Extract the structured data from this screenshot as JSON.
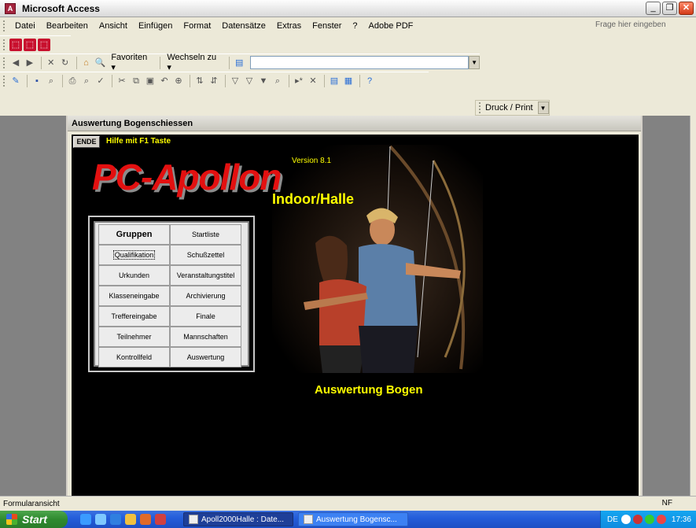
{
  "app": {
    "title": "Microsoft Access"
  },
  "menu": {
    "items": [
      "Datei",
      "Bearbeiten",
      "Ansicht",
      "Einfügen",
      "Format",
      "Datensätze",
      "Extras",
      "Fenster",
      "?",
      "Adobe PDF"
    ],
    "ask_placeholder": "Frage hier eingeben"
  },
  "web_toolbar": {
    "favoriten": "Favoriten ▾",
    "wechseln": "Wechseln zu ▾"
  },
  "print_toolbar": {
    "label": "Druck / Print"
  },
  "form": {
    "title": "Auswertung Bogenschiessen",
    "ende_label": "ENDE",
    "help_text": "Hilfe mit F1 Taste",
    "logo": "PC-Apollon",
    "version": "Version 8.1",
    "subtitle": "Indoor/Halle",
    "caption": "Auswertung Bogen",
    "buttons": [
      {
        "label": "Gruppen",
        "bold": true
      },
      {
        "label": "Startliste"
      },
      {
        "label": "Qualifikation",
        "focus": true
      },
      {
        "label": "Schußzettel"
      },
      {
        "label": "Urkunden"
      },
      {
        "label": "Veranstaltungstitel"
      },
      {
        "label": "Klasseneingabe"
      },
      {
        "label": "Archivierung"
      },
      {
        "label": "Treffereingabe"
      },
      {
        "label": "Finale"
      },
      {
        "label": "Teilnehmer"
      },
      {
        "label": "Mannschaften"
      },
      {
        "label": "Kontrollfeld"
      },
      {
        "label": "Auswertung"
      }
    ]
  },
  "status": {
    "left": "Formularansicht",
    "right": "NF"
  },
  "taskbar": {
    "start": "Start",
    "tasks": [
      "Apoll2000Halle : Date...",
      "Auswertung Bogensc..."
    ],
    "tray_lang": "DE",
    "clock": "17:36"
  }
}
